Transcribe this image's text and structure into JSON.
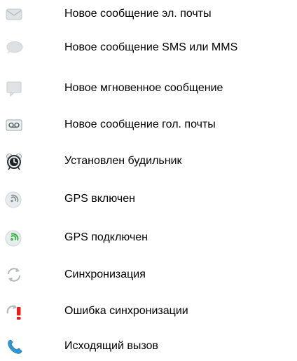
{
  "items": [
    {
      "icon": "email-icon",
      "label": "Новое сообщение эл. почты"
    },
    {
      "icon": "sms-bubble-icon",
      "label": "Новое сообщение SMS или MMS"
    },
    {
      "icon": "instant-message-icon",
      "label": "Новое мгновенное сообщение"
    },
    {
      "icon": "voicemail-icon",
      "label": "Новое сообщение гол. почты"
    },
    {
      "icon": "alarm-clock-icon",
      "label": "Установлен будильник"
    },
    {
      "icon": "gps-on-icon",
      "label": "GPS включен"
    },
    {
      "icon": "gps-connected-icon",
      "label": "GPS подключен"
    },
    {
      "icon": "sync-icon",
      "label": "Синхронизация"
    },
    {
      "icon": "sync-error-icon",
      "label": "Ошибка синхронизации"
    },
    {
      "icon": "outgoing-call-icon",
      "label": "Исходящий вызов"
    }
  ]
}
